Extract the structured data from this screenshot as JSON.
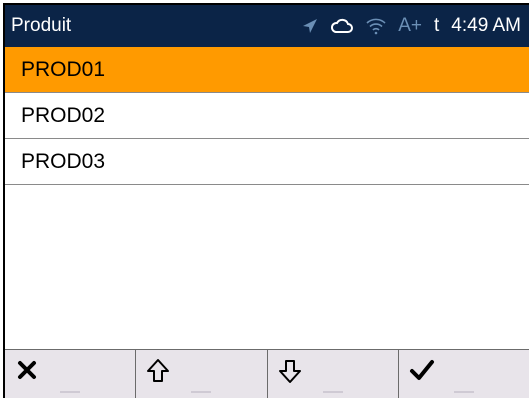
{
  "statusbar": {
    "title": "Produit",
    "icons": [
      "navigation-icon",
      "cloud-icon",
      "wifi-icon"
    ],
    "a_plus": "A+",
    "t_letter": "t",
    "time": "4:49 AM"
  },
  "list": {
    "items": [
      {
        "label": "PROD01",
        "selected": true
      },
      {
        "label": "PROD02",
        "selected": false
      },
      {
        "label": "PROD03",
        "selected": false
      }
    ]
  },
  "toolbar": {
    "buttons": [
      {
        "icon": "close-icon"
      },
      {
        "icon": "arrow-up-icon"
      },
      {
        "icon": "arrow-down-icon"
      },
      {
        "icon": "checkmark-icon"
      }
    ]
  },
  "colors": {
    "statusbar_bg": "#0b2447",
    "selected_bg": "#ff9a00",
    "toolbar_bg": "#e8e4ea"
  }
}
